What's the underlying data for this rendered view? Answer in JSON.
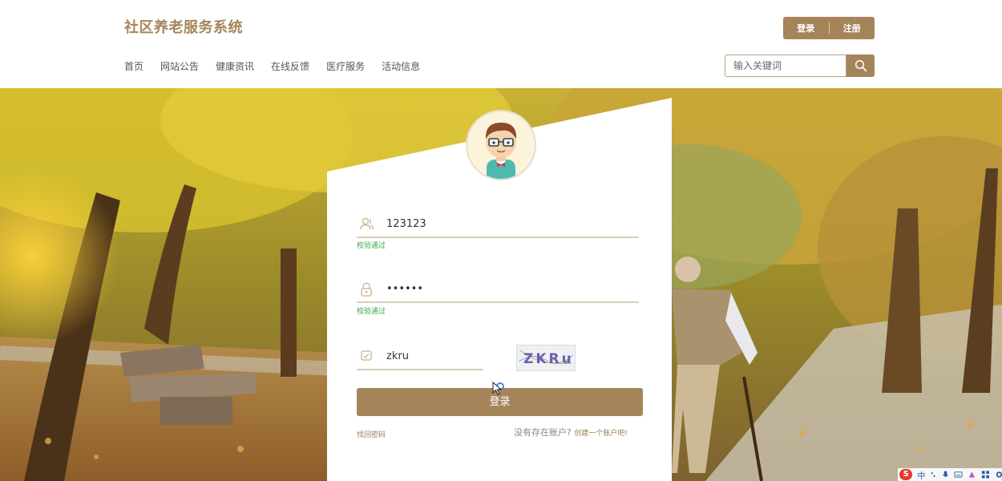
{
  "header": {
    "site_title": "社区养老服务系统",
    "login_label": "登录",
    "register_label": "注册",
    "nav": [
      "首页",
      "网站公告",
      "健康资讯",
      "在线反馈",
      "医疗服务",
      "活动信息"
    ],
    "search_placeholder": "输入关键词"
  },
  "login_form": {
    "username_value": "123123",
    "username_hint": "校验通过",
    "password_value": "••••••",
    "password_hint": "校验通过",
    "captcha_value": "zkru",
    "captcha_image_text": "ZKRu",
    "submit_label": "登录",
    "forgot_label": "找回密码",
    "no_account_text": "没有存在账户?",
    "create_account_label": "创建一个账户吧!"
  },
  "tray": {
    "ime_logo": "S",
    "ime_mode": "中"
  },
  "colors": {
    "accent": "#a6845a",
    "hint_green": "#3aa64b"
  },
  "icons": [
    "search-icon",
    "user-icon",
    "lock-icon",
    "captcha-icon",
    "avatar-cartoon-man",
    "mouse-cursor-icon"
  ]
}
